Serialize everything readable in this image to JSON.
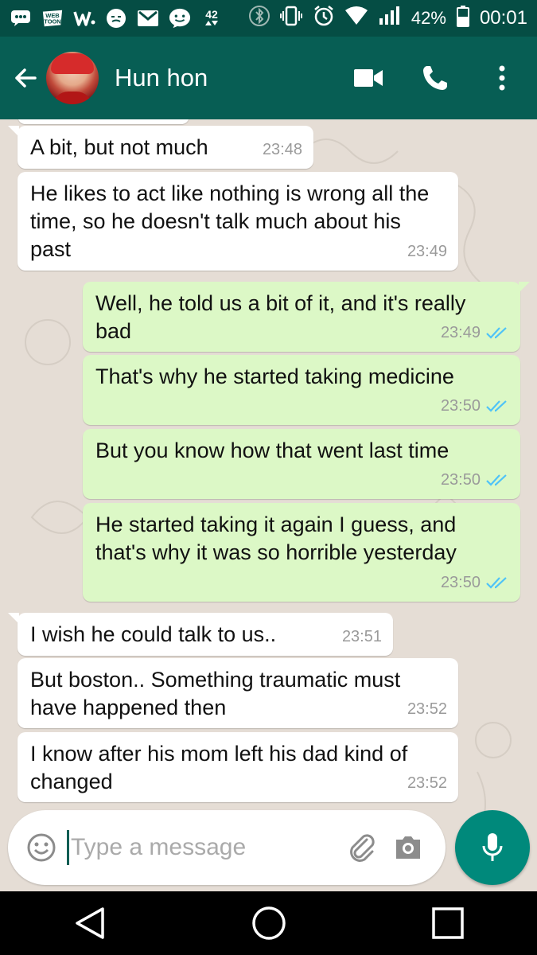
{
  "status_bar": {
    "icons": [
      "chat-icon",
      "webtoon-icon",
      "w-icon",
      "mood-icon",
      "gmail-icon",
      "messenger-icon",
      "data-42-icon",
      "bluetooth-icon",
      "vibrate-icon",
      "alarm-icon",
      "wifi-icon",
      "signal-icon",
      "battery-icon"
    ],
    "webtoon_text": "WEB TOON",
    "data_badge": "42",
    "battery_percent": "42%",
    "time": "00:01"
  },
  "header": {
    "contact_name": "Hun hon"
  },
  "messages": [
    {
      "direction": "in",
      "text": "A bit, but not much",
      "time": "23:48"
    },
    {
      "direction": "in",
      "text": "He likes to act like nothing is wrong all the time, so he doesn't talk much about his past",
      "time": "23:49"
    },
    {
      "direction": "out",
      "text": "Well, he told us a bit of it, and it's really bad",
      "time": "23:49"
    },
    {
      "direction": "out",
      "text": "That's why he started taking medicine",
      "time": "23:50"
    },
    {
      "direction": "out",
      "text": "But you know how that went last time",
      "time": "23:50"
    },
    {
      "direction": "out",
      "text": "He started taking it again I guess, and that's why it was so horrible yesterday",
      "time": "23:50"
    },
    {
      "direction": "in",
      "text": "I wish he could talk to us..",
      "time": "23:51"
    },
    {
      "direction": "in",
      "text": "But boston.. Something traumatic must have happened then",
      "time": "23:52"
    },
    {
      "direction": "in",
      "text": "I know after his mom left his dad kind of changed",
      "time": "23:52"
    }
  ],
  "input": {
    "placeholder": "Type a message",
    "value": ""
  },
  "colors": {
    "status_bar": "#054d44",
    "app_bar": "#075e54",
    "incoming_bubble": "#ffffff",
    "outgoing_bubble": "#dcf8c6",
    "read_ticks": "#4fc3f7",
    "mic_button": "#00897b",
    "chat_background": "#e5ddd5"
  }
}
